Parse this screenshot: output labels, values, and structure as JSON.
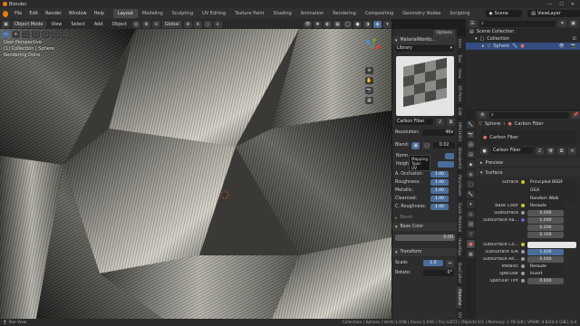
{
  "titlebar": {
    "app": "Blender",
    "minimize": "—",
    "maximize": "☐",
    "close": "✕"
  },
  "menu": [
    "File",
    "Edit",
    "Render",
    "Window",
    "Help"
  ],
  "workspaces": [
    {
      "label": "Layout",
      "active": true
    },
    {
      "label": "Modeling"
    },
    {
      "label": "Sculpting"
    },
    {
      "label": "UV Editing"
    },
    {
      "label": "Texture Paint"
    },
    {
      "label": "Shading"
    },
    {
      "label": "Animation"
    },
    {
      "label": "Rendering"
    },
    {
      "label": "Compositing"
    },
    {
      "label": "Geometry Nodes"
    },
    {
      "label": "Scripting"
    }
  ],
  "scene": {
    "label": "Scene",
    "viewlayer": "ViewLayer"
  },
  "viewport_header": {
    "mode": "Object Mode",
    "view": "View",
    "select": "Select",
    "add": "Add",
    "object": "Object",
    "orientation": "Global",
    "options": "Options"
  },
  "viewport": {
    "line1": "User Perspective",
    "line2": "(1) Collection | Sphere",
    "line3": "Rendering Done"
  },
  "nodepanel": {
    "header": "MaterialWorkb...",
    "library": "Library",
    "material": "Carbon Fiber",
    "resolution_label": "Resolution:",
    "resolution_value": "4K",
    "blend_label": "Blend:",
    "blend_value": "0.02",
    "normal_label": "Norm",
    "height_label": "Heigh",
    "tooltip_line1": "Mapping",
    "tooltip_line2": "Type:",
    "tooltip_line3": "UV",
    "fields": [
      {
        "label": "A. Occlusion:",
        "value": "1.00"
      },
      {
        "label": "Roughness:",
        "value": "1.00"
      },
      {
        "label": "Metallic:",
        "value": "1.00"
      },
      {
        "label": "Clearcoat:",
        "value": "1.00"
      },
      {
        "label": "C. Roughness:",
        "value": "1.00"
      }
    ],
    "bevel": "Bevel",
    "base_color": "Base Color",
    "base_value": "0.00",
    "transform": "Transform",
    "scale_label": "Scale:",
    "scale_value": "1.0",
    "rotate_label": "Rotate:",
    "rotate_value": "0°"
  },
  "vtabs": [
    "Item",
    "Tool",
    "View",
    "3D-Print",
    "Edit",
    "MACHIN3",
    "BlenderKit",
    "PolyHaven",
    "Quick Material",
    "HardOps",
    "BoxCutter",
    "Material",
    "UV"
  ],
  "outliner": {
    "root": "Scene Collection",
    "collection": "Collection",
    "object": "Sphere"
  },
  "properties": {
    "object": "Sphere",
    "material_tab": "Carbon Fiber",
    "slot": "Carbon Fiber",
    "slot_count": "2",
    "preview": "Preview",
    "surface_section": "Surface",
    "surface_label": "Surface",
    "surface_value": "Principled BSDF",
    "distribution": "GGX",
    "subsurface_method": "Random Walk",
    "rows": [
      {
        "label": "Base Color",
        "value": "Reroute",
        "kind": "link"
      },
      {
        "label": "Subsurface",
        "value": "0.000",
        "kind": "num"
      },
      {
        "label": "Subsurface Ra...",
        "value": "1.000",
        "kind": "num"
      },
      {
        "label": "",
        "value": "0.200",
        "kind": "num"
      },
      {
        "label": "",
        "value": "0.100",
        "kind": "num"
      },
      {
        "label": "Subsurface Co...",
        "value": "",
        "kind": "color"
      },
      {
        "label": "Subsurface IOR",
        "value": "1.400",
        "kind": "num"
      },
      {
        "label": "Subsurface An...",
        "value": "0.000",
        "kind": "num"
      },
      {
        "label": "Metallic",
        "value": "Reroute",
        "kind": "link"
      },
      {
        "label": "Specular",
        "value": "Invert",
        "kind": "link"
      },
      {
        "label": "Specular Tint",
        "value": "0.000",
        "kind": "num"
      }
    ]
  },
  "statusbar": {
    "left": "Pan View",
    "right": "Collection | Sphere | Verts:1,938 | Faces:1,936 | Tris:3,872 | Objects:1/1 | Memory: 1.78 GiB | VRAM: 4.6/24.0 GiB | 3.4"
  },
  "colors": {
    "accent": "#4c6b96",
    "active_tab": "#474747",
    "selection": "#334d80",
    "blender_orange": "#e87d0d"
  }
}
